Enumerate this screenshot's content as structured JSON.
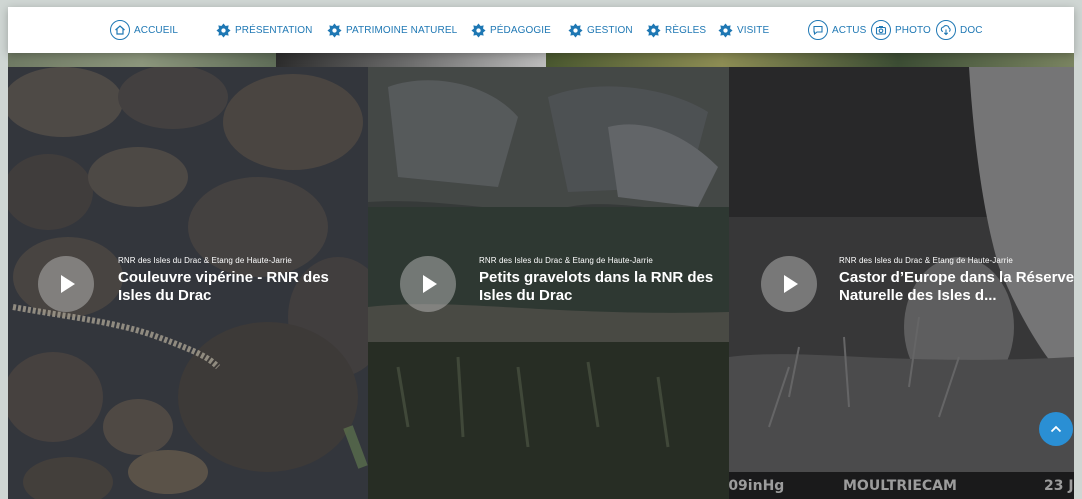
{
  "nav": {
    "accueil": "ACCUEIL",
    "presentation": "PRÉSENTATION",
    "patrimoine": "PATRIMOINE NATUREL",
    "pedagogie": "PÉDAGOGIE",
    "gestion": "GESTION",
    "regles": "RÈGLES",
    "visite": "VISITE",
    "actus": "ACTUS",
    "photo": "PHOTO",
    "doc": "DOC"
  },
  "cards": [
    {
      "source": "RNR des Isles du Drac & Etang de Haute-Jarrie",
      "title": "Couleuvre vipérine - RNR des Isles du Drac"
    },
    {
      "source": "RNR des Isles du Drac & Etang de Haute-Jarrie",
      "title": "Petits gravelots dans la RNR des Isles du Drac"
    },
    {
      "source": "RNR des Isles du Drac & Etang de Haute-Jarrie",
      "title": "Castor d’Europe dans la Réserve Naturelle des Isles d..."
    }
  ],
  "camera_overlay": {
    "pressure": ".09inHg",
    "brand": "MOULTRIECAM",
    "date": "23 J"
  },
  "colors": {
    "nav_text": "#1f78b4",
    "scroll_button": "#2a8fd4"
  }
}
